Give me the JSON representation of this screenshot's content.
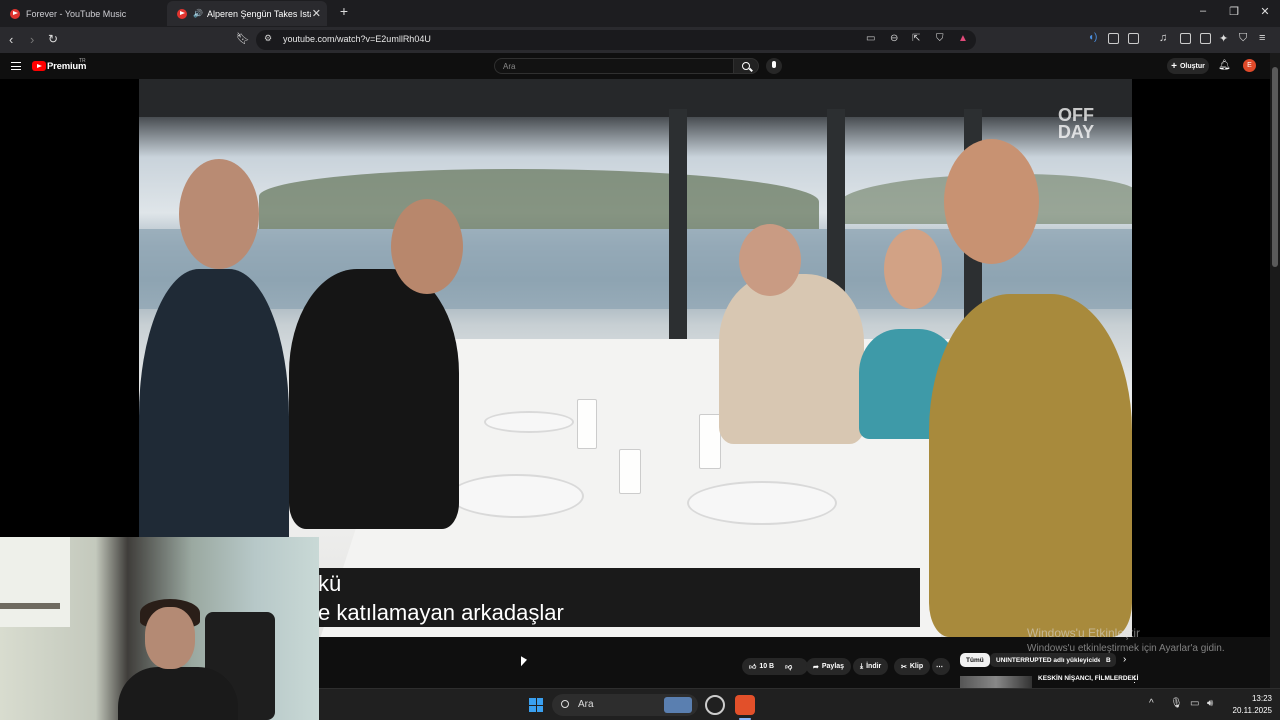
{
  "browser": {
    "tabs": [
      {
        "label": "Forever - YouTube Music"
      },
      {
        "label": "Alperen Şengün Takes Istanb"
      }
    ],
    "url": "youtube.com/watch?v=E2umllRh04U"
  },
  "youtube": {
    "brand": "Premium",
    "brand_sup": "TR",
    "search_placeholder": "Ara",
    "create_label": "Oluştur",
    "avatar_letter": "E"
  },
  "video": {
    "watermark": "OFF DAY",
    "subtitle_line1": "kü",
    "subtitle_line2": "e katılamayan arkadaşlar"
  },
  "actions": {
    "like_count": "10 B",
    "share": "Paylaş",
    "download": "İndir",
    "clip": "Klip"
  },
  "chips": [
    "Tümü",
    "UNINTERRUPTED adlı yükleyiciden",
    "B"
  ],
  "recommendation": {
    "title": "KESKİN NİŞANCI, FİLMLERDEKİ"
  },
  "windows_activation": {
    "line1": "Windows'u Etkinleştir",
    "line2": "Windows'u etkinleştirmek için Ayarlar'a gidin."
  },
  "taskbar": {
    "search": "Ara",
    "time": "13:23",
    "date": "20.11.2025"
  }
}
